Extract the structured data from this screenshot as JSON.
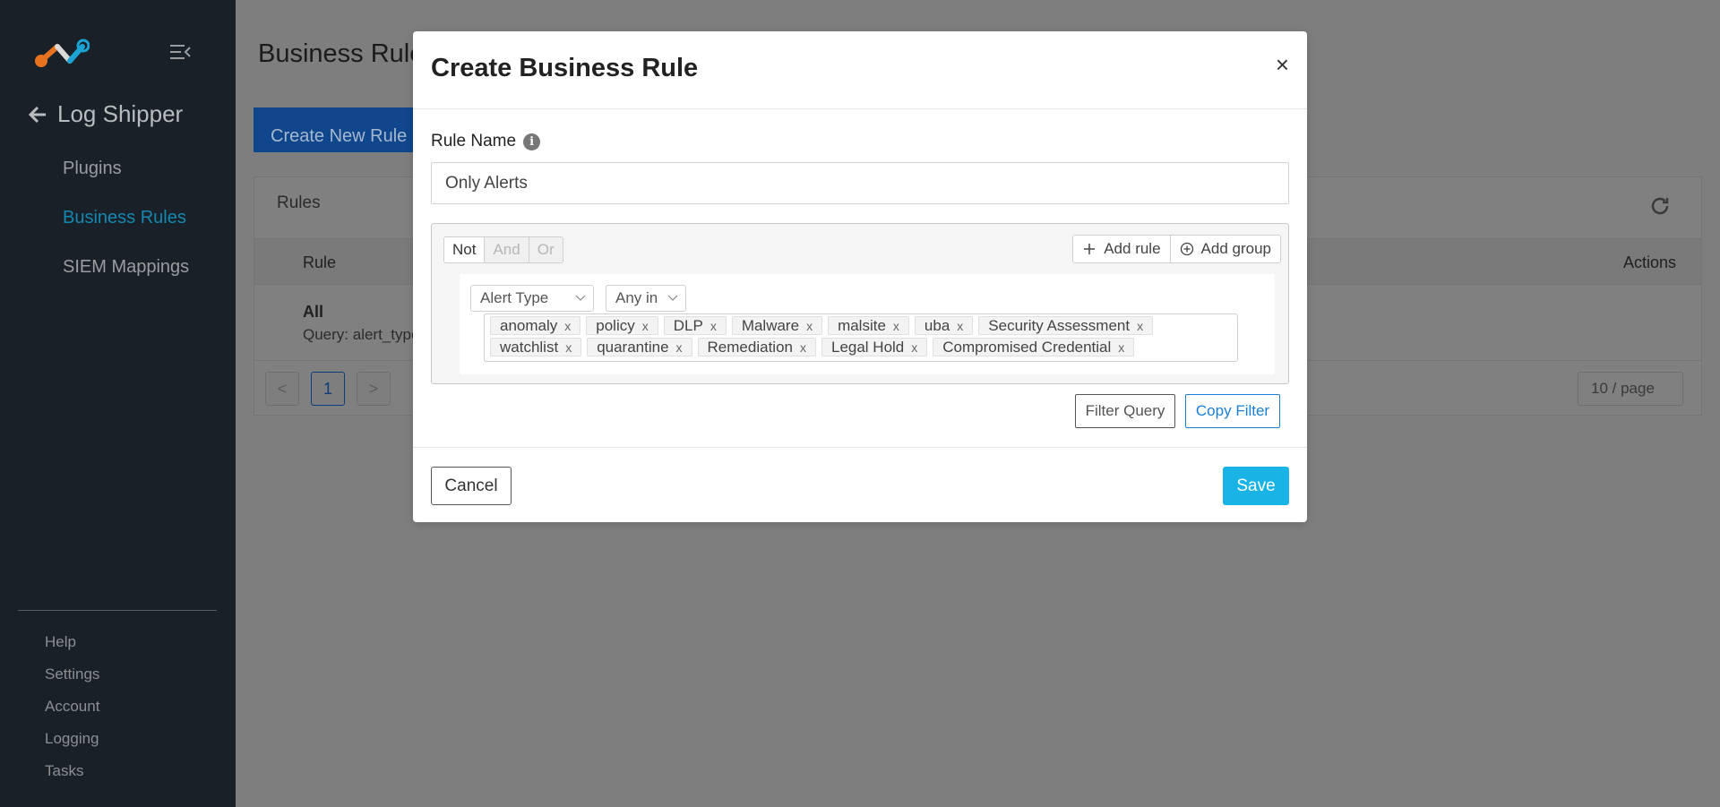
{
  "sidebar": {
    "app_title": "Log Shipper",
    "nav": [
      {
        "label": "Plugins",
        "active": false
      },
      {
        "label": "Business Rules",
        "active": true
      },
      {
        "label": "SIEM Mappings",
        "active": false
      }
    ],
    "footer": [
      "Help",
      "Settings",
      "Account",
      "Logging",
      "Tasks"
    ]
  },
  "page": {
    "title": "Business Rules",
    "create_button": "Create New Rule",
    "card_title": "Rules",
    "columns": {
      "rule": "Rule",
      "actions": "Actions"
    },
    "rows": [
      {
        "name": "All",
        "query": "Query: alert_type"
      }
    ],
    "pagination": {
      "current": "1",
      "prev": "<",
      "next": ">",
      "page_size": "10 / page"
    }
  },
  "modal": {
    "title": "Create Business Rule",
    "close": "×",
    "rule_name_label": "Rule Name",
    "rule_name_value": "Only Alerts",
    "conjunctions": [
      "Not",
      "And",
      "Or"
    ],
    "add_rule": "Add rule",
    "add_group": "Add group",
    "rule": {
      "field": "Alert Type",
      "operator": "Any in",
      "values": [
        "anomaly",
        "policy",
        "DLP",
        "Malware",
        "malsite",
        "uba",
        "Security Assessment",
        "watchlist",
        "quarantine",
        "Remediation",
        "Legal Hold",
        "Compromised Credential"
      ]
    },
    "filter_query_button": "Filter Query",
    "copy_filter_button": "Copy Filter",
    "cancel_button": "Cancel",
    "save_button": "Save"
  },
  "colors": {
    "sidebar_bg": "#1a2027",
    "active_nav": "#1488b0",
    "primary": "#19b3e6",
    "link_blue": "#1a7fd8"
  }
}
